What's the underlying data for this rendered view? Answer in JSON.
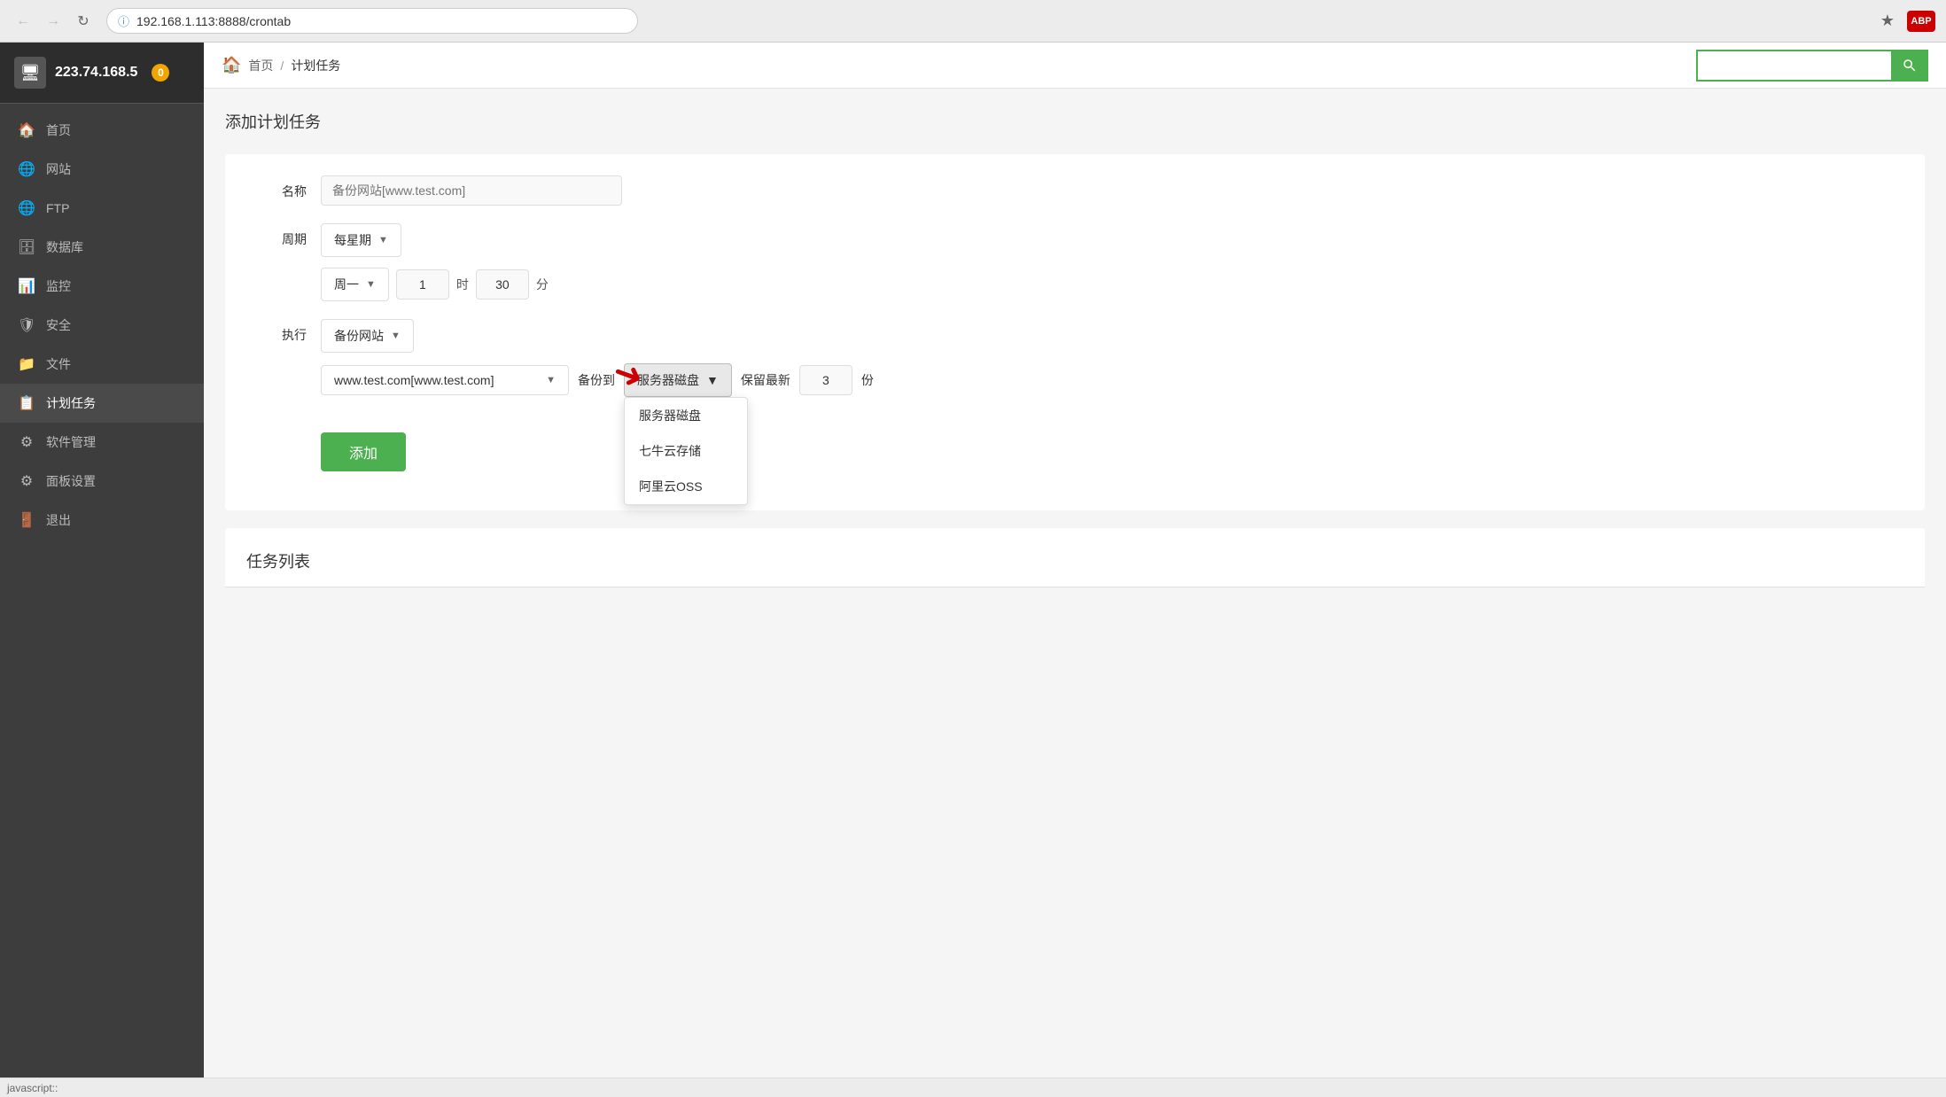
{
  "browser": {
    "url_protocol": "192.168.1.113:",
    "url_path": "8888/crontab",
    "url_display": "192.168.1.113:8888/crontab",
    "status_text": "javascript::"
  },
  "sidebar": {
    "ip": "223.74.168.5",
    "badge": "0",
    "items": [
      {
        "id": "home",
        "label": "首页",
        "icon": "🏠",
        "active": false
      },
      {
        "id": "website",
        "label": "网站",
        "icon": "🌐",
        "active": false
      },
      {
        "id": "ftp",
        "label": "FTP",
        "icon": "🌐",
        "active": false
      },
      {
        "id": "database",
        "label": "数据库",
        "icon": "🗄",
        "active": false
      },
      {
        "id": "monitor",
        "label": "监控",
        "icon": "📊",
        "active": false
      },
      {
        "id": "security",
        "label": "安全",
        "icon": "🛡",
        "active": false
      },
      {
        "id": "files",
        "label": "文件",
        "icon": "📁",
        "active": false
      },
      {
        "id": "crontab",
        "label": "计划任务",
        "icon": "📋",
        "active": true
      },
      {
        "id": "software",
        "label": "软件管理",
        "icon": "⚙",
        "active": false
      },
      {
        "id": "panel",
        "label": "面板设置",
        "icon": "⚙",
        "active": false
      },
      {
        "id": "logout",
        "label": "退出",
        "icon": "🚪",
        "active": false
      }
    ]
  },
  "header": {
    "home_label": "首页",
    "separator": "/",
    "current_page": "计划任务",
    "search_placeholder": ""
  },
  "page": {
    "add_task_title": "添加计划任务",
    "task_list_title": "任务列表",
    "form": {
      "name_label": "名称",
      "name_placeholder": "备份网站[www.test.com]",
      "period_label": "周期",
      "period_value": "每星期",
      "period_day_value": "周一",
      "period_hour_value": "1",
      "period_hour_unit": "时",
      "period_minute_value": "30",
      "period_minute_unit": "分",
      "execute_label": "执行",
      "execute_value": "备份网站",
      "website_value": "www.test.com[www.test.com]",
      "backup_to_label": "备份到",
      "backup_to_value": "服务器磁盘",
      "keep_latest_label": "保留最新",
      "keep_latest_value": "3",
      "keep_latest_unit": "份",
      "add_button": "添加",
      "dropdown_options": [
        {
          "value": "server_disk",
          "label": "服务器磁盘"
        },
        {
          "value": "qiniu",
          "label": "七牛云存储"
        },
        {
          "value": "aliyun_oss",
          "label": "阿里云OSS"
        }
      ]
    }
  },
  "colors": {
    "green": "#4caf50",
    "sidebar_bg": "#3d3d3d",
    "sidebar_active": "#4a4a4a",
    "sidebar_header": "#2d2d2d",
    "red": "#cc0000",
    "orange_badge": "#f0a500"
  }
}
